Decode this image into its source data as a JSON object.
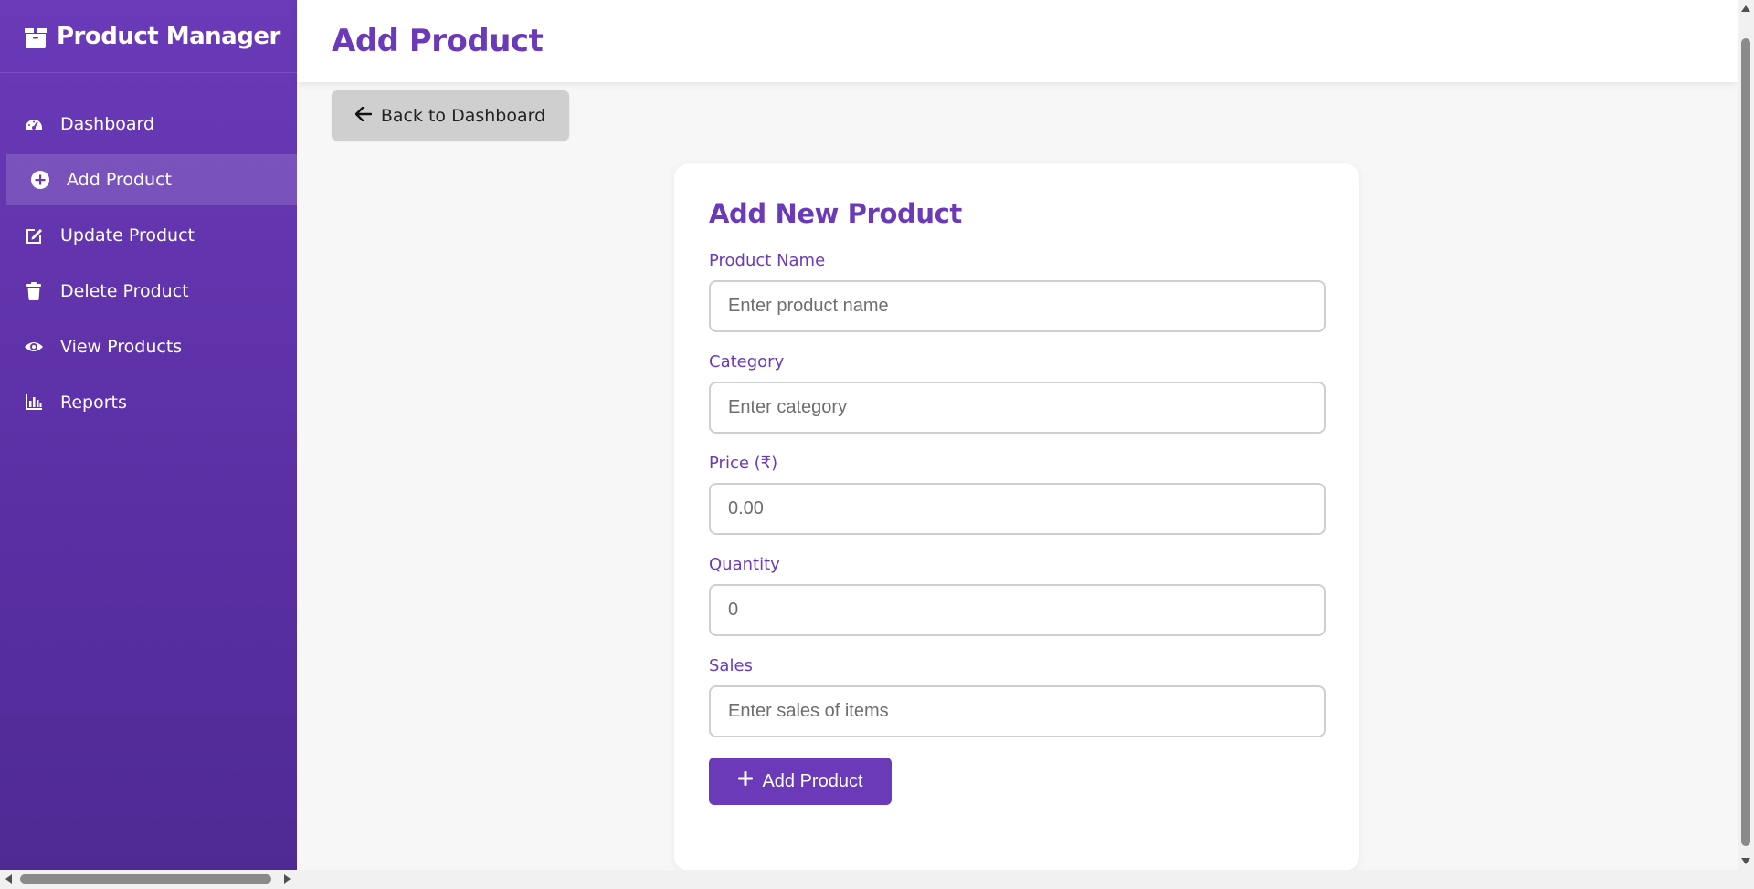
{
  "sidebar": {
    "brand": "Product Manager",
    "items": [
      {
        "label": "Dashboard",
        "icon": "gauge-icon"
      },
      {
        "label": "Add Product",
        "icon": "plus-circle-icon",
        "active": true
      },
      {
        "label": "Update Product",
        "icon": "edit-icon"
      },
      {
        "label": "Delete Product",
        "icon": "trash-icon"
      },
      {
        "label": "View Products",
        "icon": "eye-icon"
      },
      {
        "label": "Reports",
        "icon": "bar-chart-icon"
      }
    ]
  },
  "header": {
    "title": "Add Product"
  },
  "back_button": {
    "label": "Back to Dashboard",
    "icon": "arrow-left-icon"
  },
  "form": {
    "title": "Add New Product",
    "fields": [
      {
        "label": "Product Name",
        "placeholder": "Enter product name"
      },
      {
        "label": "Category",
        "placeholder": "Enter category"
      },
      {
        "label": "Price (₹)",
        "placeholder": "0.00"
      },
      {
        "label": "Quantity",
        "placeholder": "0"
      },
      {
        "label": "Sales",
        "placeholder": "Enter sales of items"
      }
    ],
    "submit_label": "Add Product",
    "submit_icon": "plus-icon"
  },
  "colors": {
    "accent": "#6a3ab8",
    "sidebar_top": "#6a3ab8",
    "sidebar_bottom": "#4f2a94",
    "back_button_bg": "#cfcfcf"
  }
}
